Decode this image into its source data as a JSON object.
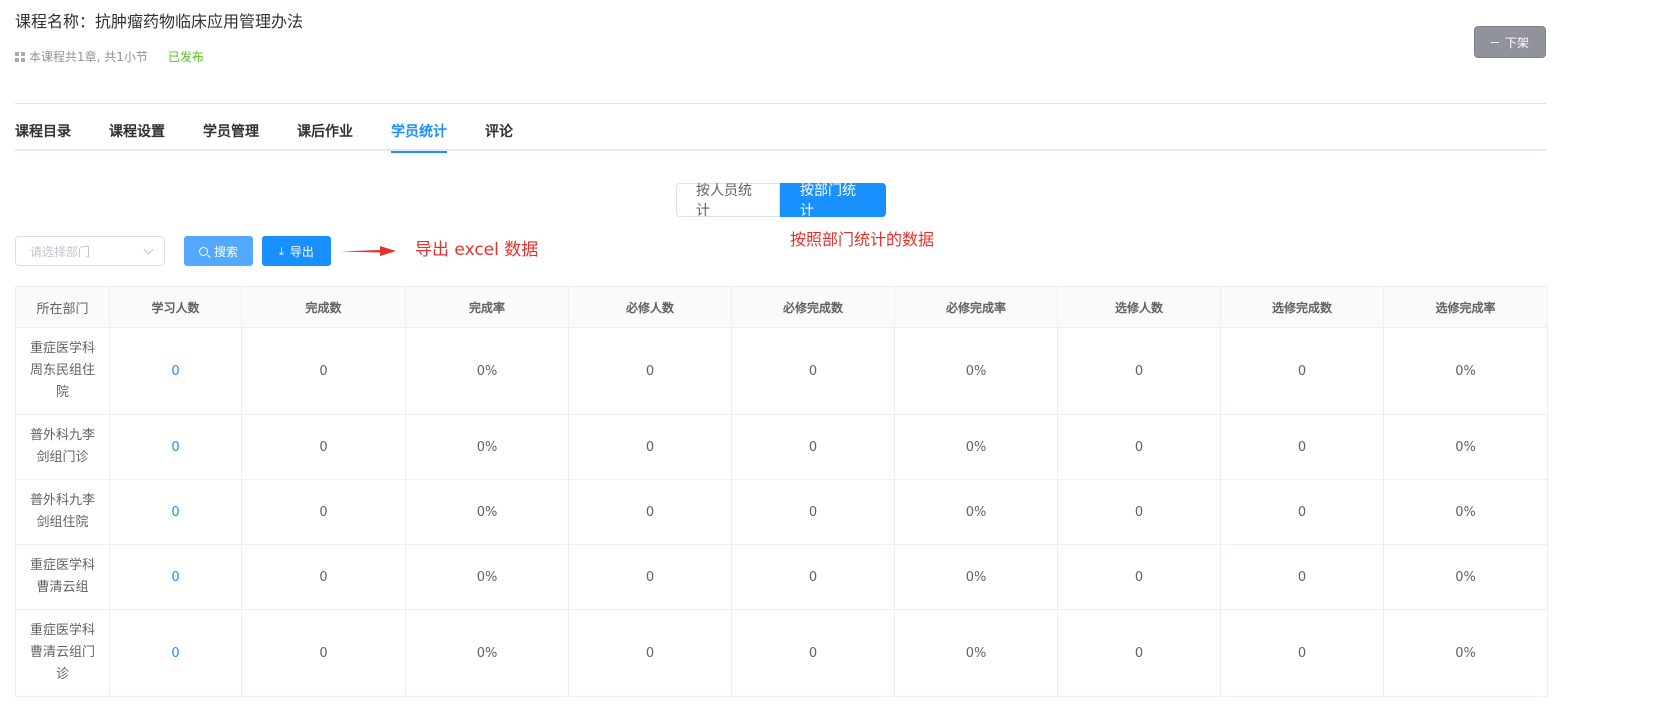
{
  "course": {
    "title": "课程名称：抗肿瘤药物临床应用管理办法",
    "chapters": "本课程共1章, 共1小节",
    "status": "已发布"
  },
  "header": {
    "unpublish_label": "下架"
  },
  "tabs": [
    {
      "label": "课程目录"
    },
    {
      "label": "课程设置"
    },
    {
      "label": "学员管理"
    },
    {
      "label": "课后作业"
    },
    {
      "label": "学员统计"
    },
    {
      "label": "评论"
    }
  ],
  "toggle": {
    "by_person": "按人员统计",
    "by_department": "按部门统计"
  },
  "filters": {
    "department_placeholder": "请选择部门",
    "search_label": "搜索",
    "export_label": "导出"
  },
  "annotations": {
    "export_note": "导出 excel 数据",
    "department_note": "按照部门统计的数据"
  },
  "table": {
    "headers": [
      "所在部门",
      "学习人数",
      "完成数",
      "完成率",
      "必修人数",
      "必修完成数",
      "必修完成率",
      "选修人数",
      "选修完成数",
      "选修完成率"
    ],
    "rows": [
      {
        "dept": "重症医学科周东民组住院",
        "learners": "0",
        "completed": "0",
        "rate": "0%",
        "req": "0",
        "req_done": "0",
        "req_rate": "0%",
        "elec": "0",
        "elec_done": "0",
        "elec_rate": "0%"
      },
      {
        "dept": "普外科九李剑组门诊",
        "learners": "0",
        "completed": "0",
        "rate": "0%",
        "req": "0",
        "req_done": "0",
        "req_rate": "0%",
        "elec": "0",
        "elec_done": "0",
        "elec_rate": "0%"
      },
      {
        "dept": "普外科九李剑组住院",
        "learners": "0",
        "completed": "0",
        "rate": "0%",
        "req": "0",
        "req_done": "0",
        "req_rate": "0%",
        "elec": "0",
        "elec_done": "0",
        "elec_rate": "0%"
      },
      {
        "dept": "重症医学科曹清云组",
        "learners": "0",
        "completed": "0",
        "rate": "0%",
        "req": "0",
        "req_done": "0",
        "req_rate": "0%",
        "elec": "0",
        "elec_done": "0",
        "elec_rate": "0%"
      },
      {
        "dept": "重症医学科曹清云组门诊",
        "learners": "0",
        "completed": "0",
        "rate": "0%",
        "req": "0",
        "req_done": "0",
        "req_rate": "0%",
        "elec": "0",
        "elec_done": "0",
        "elec_rate": "0%"
      }
    ]
  },
  "colors": {
    "primary": "#1890ff",
    "published": "#52c41a",
    "annotation": "#e4312b"
  }
}
